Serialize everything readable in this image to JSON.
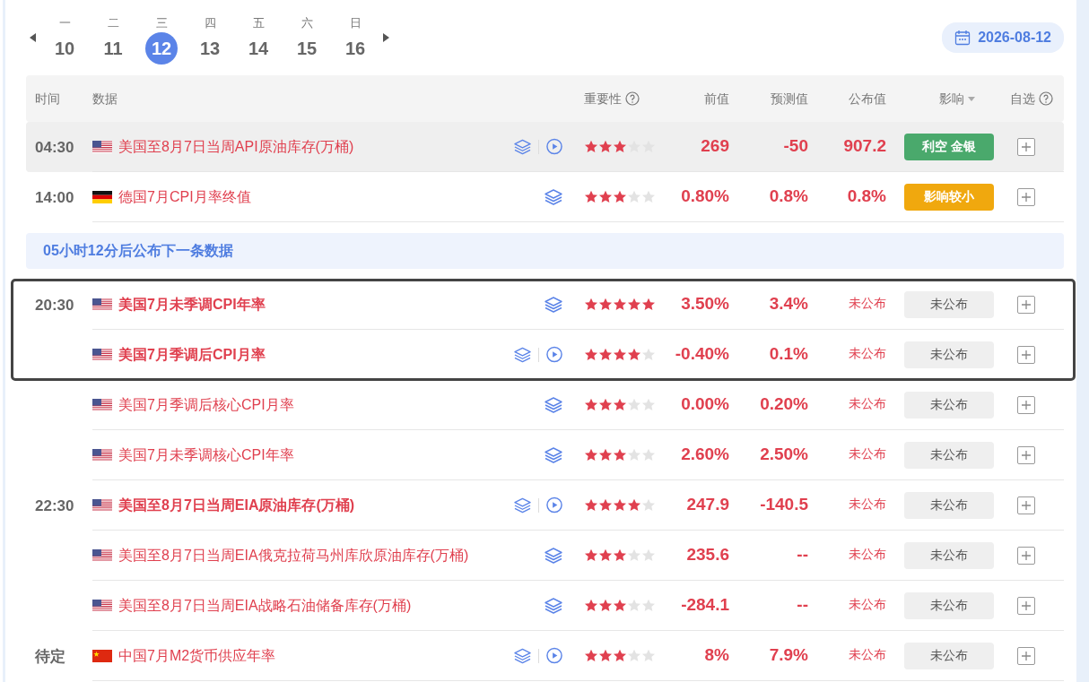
{
  "week": {
    "days": [
      {
        "weekday": "一",
        "day": "10",
        "selected": false
      },
      {
        "weekday": "二",
        "day": "11",
        "selected": false
      },
      {
        "weekday": "三",
        "day": "12",
        "selected": true
      },
      {
        "weekday": "四",
        "day": "13",
        "selected": false
      },
      {
        "weekday": "五",
        "day": "14",
        "selected": false
      },
      {
        "weekday": "六",
        "day": "15",
        "selected": false
      },
      {
        "weekday": "日",
        "day": "16",
        "selected": false
      }
    ],
    "date": "2026-08-12"
  },
  "table": {
    "columns": [
      "时间",
      "数据",
      "重要性",
      "前值",
      "预测值",
      "公布值",
      "影响",
      "自选"
    ],
    "sections": [
      {
        "kind": "group",
        "time": "04:30",
        "highlighted": true,
        "boxed": false,
        "rows": [
          {
            "kind": "us",
            "title": "美国至8月7日当周API原油库存(万桶)",
            "bold": false,
            "video": true,
            "stars": 3,
            "previous": "269",
            "forecast": "-50",
            "actual": "907.2",
            "released": true,
            "impact": {
              "kind": "bearish",
              "label": "利空 金银"
            }
          }
        ]
      },
      {
        "kind": "group",
        "time": "14:00",
        "highlighted": false,
        "boxed": false,
        "rows": [
          {
            "kind": "de",
            "title": "德国7月CPI月率终值",
            "bold": false,
            "video": false,
            "stars": 3,
            "previous": "0.80%",
            "forecast": "0.8%",
            "actual": "0.8%",
            "released": true,
            "impact": {
              "kind": "minor",
              "label": "影响较小"
            }
          }
        ]
      },
      {
        "kind": "notice",
        "text": "05小时12分后公布下一条数据"
      },
      {
        "kind": "group",
        "time": "20:30",
        "highlighted": false,
        "boxed": true,
        "rows": [
          {
            "kind": "us",
            "title": "美国7月未季调CPI年率",
            "bold": true,
            "video": false,
            "stars": 5,
            "previous": "3.50%",
            "forecast": "3.4%",
            "actual": "未公布",
            "released": false,
            "impact": {
              "kind": "pending",
              "label": "未公布"
            }
          },
          {
            "kind": "us",
            "title": "美国7月季调后CPI月率",
            "bold": true,
            "video": true,
            "stars": 4,
            "previous": "-0.40%",
            "forecast": "0.1%",
            "actual": "未公布",
            "released": false,
            "impact": {
              "kind": "pending",
              "label": "未公布"
            }
          }
        ]
      },
      {
        "kind": "group",
        "highlighted": false,
        "boxed": false,
        "rows": [
          {
            "kind": "us",
            "title": "美国7月季调后核心CPI月率",
            "bold": false,
            "video": false,
            "stars": 3,
            "previous": "0.00%",
            "forecast": "0.20%",
            "actual": "未公布",
            "released": false,
            "impact": {
              "kind": "pending",
              "label": "未公布"
            }
          },
          {
            "kind": "us",
            "title": "美国7月未季调核心CPI年率",
            "bold": false,
            "video": false,
            "stars": 3,
            "previous": "2.60%",
            "forecast": "2.50%",
            "actual": "未公布",
            "released": false,
            "impact": {
              "kind": "pending",
              "label": "未公布"
            }
          }
        ]
      },
      {
        "kind": "group",
        "time": "22:30",
        "highlighted": false,
        "boxed": false,
        "rows": [
          {
            "kind": "us",
            "title": "美国至8月7日当周EIA原油库存(万桶)",
            "bold": true,
            "video": true,
            "stars": 4,
            "previous": "247.9",
            "forecast": "-140.5",
            "actual": "未公布",
            "released": false,
            "impact": {
              "kind": "pending",
              "label": "未公布"
            }
          },
          {
            "kind": "us",
            "title": "美国至8月7日当周EIA俄克拉荷马州库欣原油库存(万桶)",
            "bold": false,
            "video": false,
            "stars": 3,
            "previous": "235.6",
            "forecast": "--",
            "actual": "未公布",
            "released": false,
            "impact": {
              "kind": "pending",
              "label": "未公布"
            }
          },
          {
            "kind": "us",
            "title": "美国至8月7日当周EIA战略石油储备库存(万桶)",
            "bold": false,
            "video": false,
            "stars": 3,
            "previous": "-284.1",
            "forecast": "--",
            "actual": "未公布",
            "released": false,
            "impact": {
              "kind": "pending",
              "label": "未公布"
            }
          }
        ]
      },
      {
        "kind": "group",
        "time": "待定",
        "highlighted": false,
        "boxed": false,
        "rows": [
          {
            "kind": "cn",
            "title": "中国7月M2货币供应年率",
            "bold": false,
            "video": true,
            "stars": 3,
            "previous": "8%",
            "forecast": "7.9%",
            "actual": "未公布",
            "released": false,
            "impact": {
              "kind": "pending",
              "label": "未公布"
            }
          }
        ]
      }
    ]
  }
}
